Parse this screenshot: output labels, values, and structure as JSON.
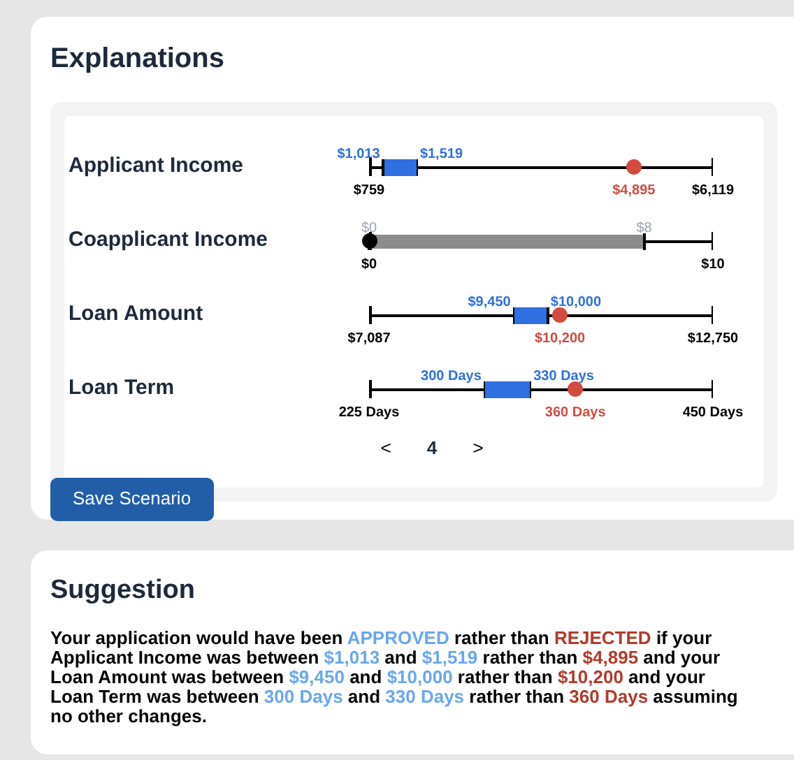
{
  "explanations": {
    "title": "Explanations",
    "rows": [
      {
        "label": "Applicant Income",
        "kind": "range",
        "min": "$759",
        "max": "$6,119",
        "low": {
          "label": "$1,013",
          "level": 0.04
        },
        "high": {
          "label": "$1,519",
          "level": 0.14
        },
        "current": {
          "label": "$4,895",
          "level": 0.77
        }
      },
      {
        "label": "Coapplicant Income",
        "kind": "muted",
        "min": "$0",
        "max": "$10",
        "low": {
          "label": "$0",
          "level": 0
        },
        "high": {
          "label": "$8",
          "level": 0.8
        },
        "current": {
          "level": 0
        }
      },
      {
        "label": "Loan Amount",
        "kind": "range",
        "min": "$7,087",
        "max": "$12,750",
        "low": {
          "label": "$9,450",
          "level": 0.42
        },
        "high": {
          "label": "$10,000",
          "level": 0.52
        },
        "current": {
          "label": "$10,200",
          "level": 0.555
        }
      },
      {
        "label": "Loan Term",
        "kind": "range",
        "min": "225 Days",
        "max": "450 Days",
        "low": {
          "label": "300 Days",
          "level": 0.335
        },
        "high": {
          "label": "330 Days",
          "level": 0.47
        },
        "current": {
          "label": "360 Days",
          "level": 0.6
        }
      }
    ],
    "pager": {
      "prev": "<",
      "page": "4",
      "next": ">"
    },
    "save_button": "Save Scenario"
  },
  "suggestion": {
    "title": "Suggestion",
    "segments": [
      {
        "kind": "text",
        "text": "Your application would have been "
      },
      {
        "kind": "good",
        "text": "APPROVED"
      },
      {
        "kind": "text",
        "text": " rather than "
      },
      {
        "kind": "bad",
        "text": "REJECTED"
      },
      {
        "kind": "text",
        "text": " if your Applicant Income was between "
      },
      {
        "kind": "good",
        "text": "$1,013"
      },
      {
        "kind": "text",
        "text": " and "
      },
      {
        "kind": "good",
        "text": "$1,519"
      },
      {
        "kind": "text",
        "text": " rather than "
      },
      {
        "kind": "bad",
        "text": "$4,895"
      },
      {
        "kind": "text",
        "text": " and your Loan Amount was between "
      },
      {
        "kind": "good",
        "text": "$9,450"
      },
      {
        "kind": "text",
        "text": " and "
      },
      {
        "kind": "good",
        "text": "$10,000"
      },
      {
        "kind": "text",
        "text": " rather than "
      },
      {
        "kind": "bad",
        "text": "$10,200"
      },
      {
        "kind": "text",
        "text": " and your Loan Term was between "
      },
      {
        "kind": "good",
        "text": "300 Days"
      },
      {
        "kind": "text",
        "text": " and "
      },
      {
        "kind": "good",
        "text": "330 Days"
      },
      {
        "kind": "text",
        "text": " rather than "
      },
      {
        "kind": "bad",
        "text": "360 Days"
      },
      {
        "kind": "text",
        "text": " assuming no other changes."
      }
    ]
  }
}
